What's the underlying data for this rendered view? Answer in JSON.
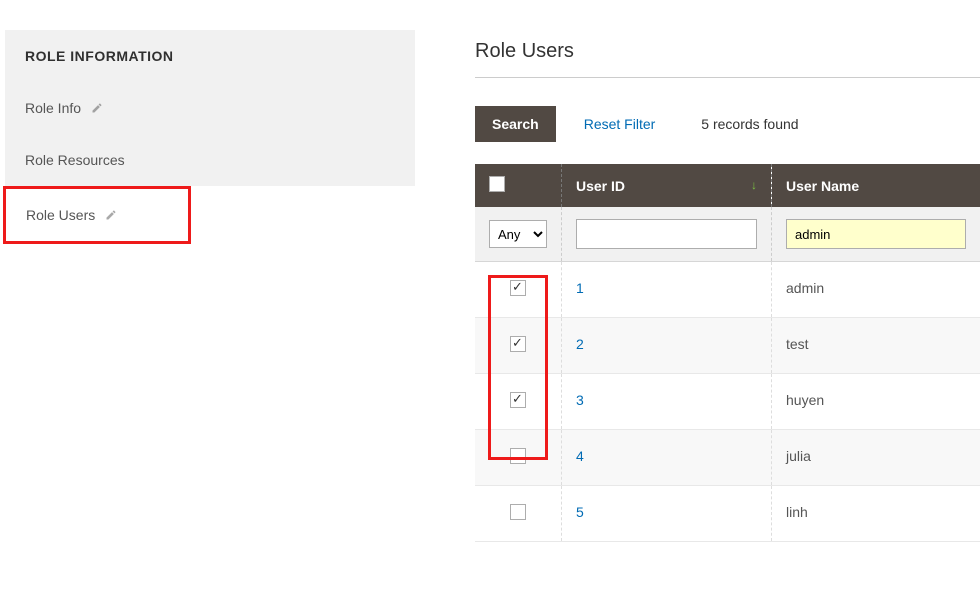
{
  "sidebar": {
    "heading": "ROLE INFORMATION",
    "items": [
      {
        "label": "Role Info",
        "has_icon": true,
        "active": false
      },
      {
        "label": "Role Resources",
        "has_icon": false,
        "active": false
      },
      {
        "label": "Role Users",
        "has_icon": true,
        "active": true
      }
    ]
  },
  "main": {
    "title": "Role Users",
    "toolbar": {
      "search_label": "Search",
      "reset_label": "Reset Filter",
      "records_text": "5 records found"
    },
    "table": {
      "headers": {
        "user_id": "User ID",
        "user_name": "User Name"
      },
      "filter": {
        "any_option": "Any",
        "user_id_value": "",
        "user_name_value": "admin"
      },
      "rows": [
        {
          "checked": true,
          "user_id": "1",
          "user_name": "admin"
        },
        {
          "checked": true,
          "user_id": "2",
          "user_name": "test"
        },
        {
          "checked": true,
          "user_id": "3",
          "user_name": "huyen"
        },
        {
          "checked": false,
          "user_id": "4",
          "user_name": "julia"
        },
        {
          "checked": false,
          "user_id": "5",
          "user_name": "linh"
        }
      ]
    }
  }
}
